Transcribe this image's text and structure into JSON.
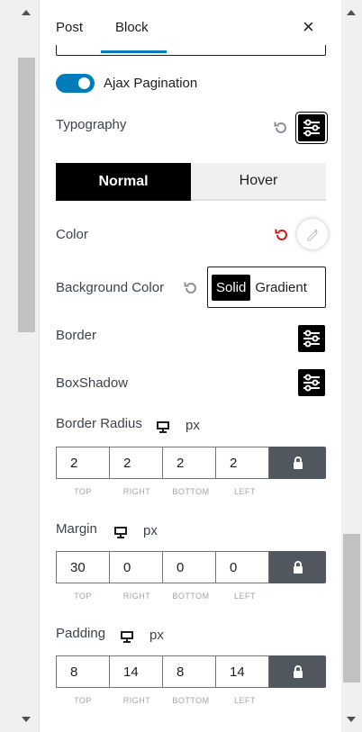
{
  "tabs": {
    "post": "Post",
    "block": "Block"
  },
  "close_glyph": "×",
  "ajax_pagination": {
    "label": "Ajax Pagination",
    "enabled": true
  },
  "typography": {
    "label": "Typography"
  },
  "state_tabs": {
    "normal": "Normal",
    "hover": "Hover",
    "active": "Normal"
  },
  "color": {
    "label": "Color",
    "reset_color": "#cc1818"
  },
  "background_color": {
    "label": "Background Color",
    "solid": "Solid",
    "gradient": "Gradient",
    "active": "Solid"
  },
  "border": {
    "label": "Border"
  },
  "box_shadow": {
    "label": "BoxShadow"
  },
  "border_radius": {
    "label": "Border Radius",
    "unit": "px",
    "values": [
      "2",
      "2",
      "2",
      "2"
    ],
    "sides": [
      "TOP",
      "RIGHT",
      "BOTTOM",
      "LEFT"
    ]
  },
  "margin": {
    "label": "Margin",
    "unit": "px",
    "values": [
      "30",
      "0",
      "0",
      "0"
    ],
    "sides": [
      "TOP",
      "RIGHT",
      "BOTTOM",
      "LEFT"
    ]
  },
  "padding": {
    "label": "Padding",
    "unit": "px",
    "values": [
      "8",
      "14",
      "8",
      "14"
    ],
    "sides": [
      "TOP",
      "RIGHT",
      "BOTTOM",
      "LEFT"
    ]
  },
  "icons": {
    "reset": "reset-icon",
    "settings": "sliders-icon",
    "device": "desktop-icon",
    "lock": "lock-icon",
    "close": "close-icon",
    "color_picker": "eyedropper-icon"
  },
  "colors": {
    "accent": "#007cba",
    "dark": "#000000",
    "lock_bg": "#50575e"
  }
}
